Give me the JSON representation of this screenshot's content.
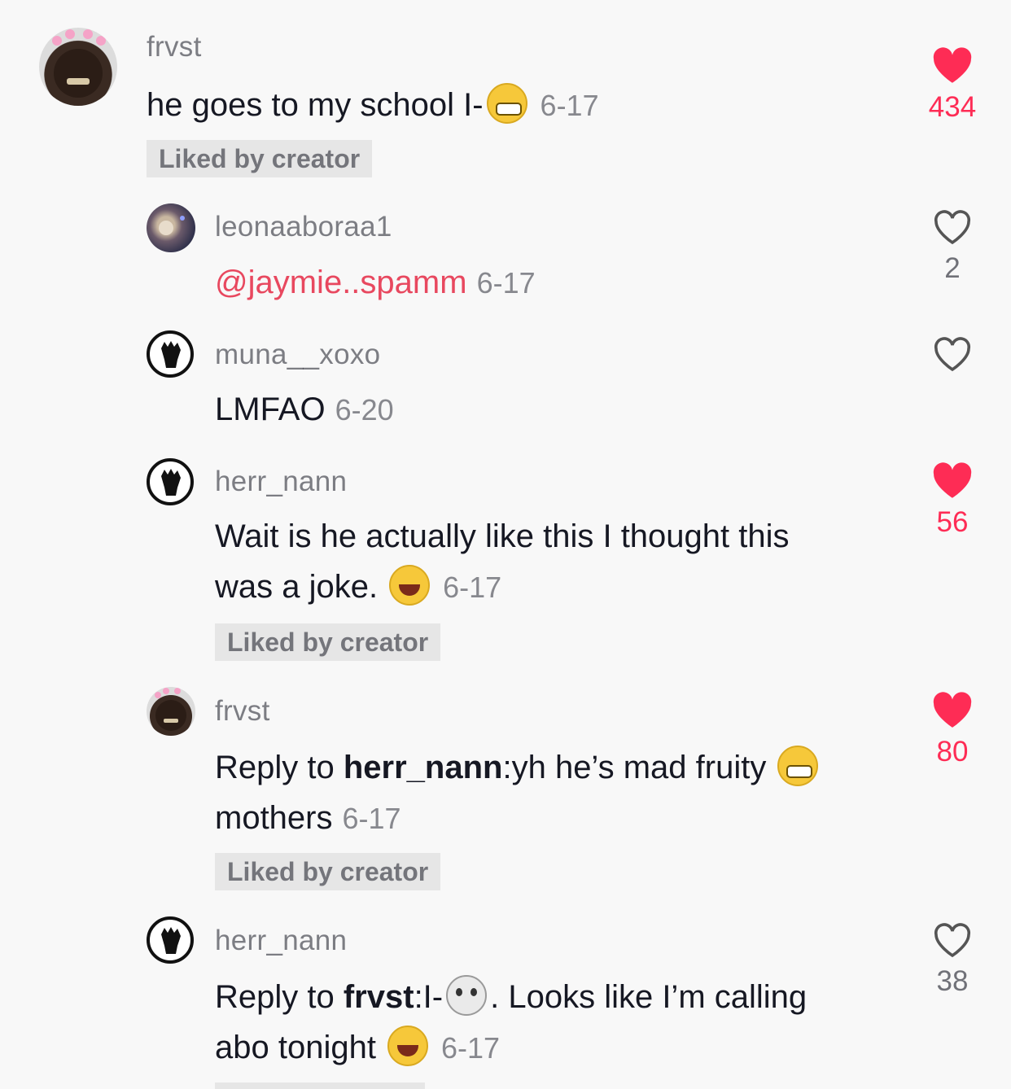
{
  "colors": {
    "accent": "#fe2c55",
    "mention": "#e8485f",
    "text": "#161823",
    "muted": "rgba(22,24,35,0.5)"
  },
  "liked_badge": "Liked by creator",
  "comments": [
    {
      "username": "frvst",
      "text": "he goes to my school I-",
      "date": "6-17",
      "likes": "434",
      "liked": true,
      "avatar_icon": "kodak-face-avatar"
    },
    {
      "username": "leonaaboraa1",
      "mention": "@jaymie..spamm",
      "date": "6-17",
      "likes": "2",
      "liked": false,
      "avatar_icon": "photo-avatar"
    },
    {
      "username": "muna__xoxo",
      "text": "LMFAO",
      "date": "6-20",
      "likes": "",
      "liked": false,
      "avatar_icon": "raised-fist-avatar"
    },
    {
      "username": "herr_nann",
      "text_line1": "Wait is he actually like this I thought this",
      "text_line2": "was a joke.",
      "date": "6-17",
      "likes": "56",
      "liked": true,
      "avatar_icon": "raised-fist-avatar"
    },
    {
      "username": "frvst",
      "reply_prefix": "Reply to ",
      "reply_to": "herr_nann",
      "text_line1": ":yh he’s mad fruity",
      "text_line2": "mothers",
      "date": "6-17",
      "likes": "80",
      "liked": true,
      "avatar_icon": "kodak-face-avatar"
    },
    {
      "username": "herr_nann",
      "reply_prefix": "Reply to ",
      "reply_to": "frvst",
      "text_part1": ":I-",
      "text_part2": ". Looks like I’m calling",
      "text_line2": "abo tonight",
      "date": "6-17",
      "likes": "38",
      "liked": false,
      "avatar_icon": "raised-fist-avatar"
    }
  ]
}
